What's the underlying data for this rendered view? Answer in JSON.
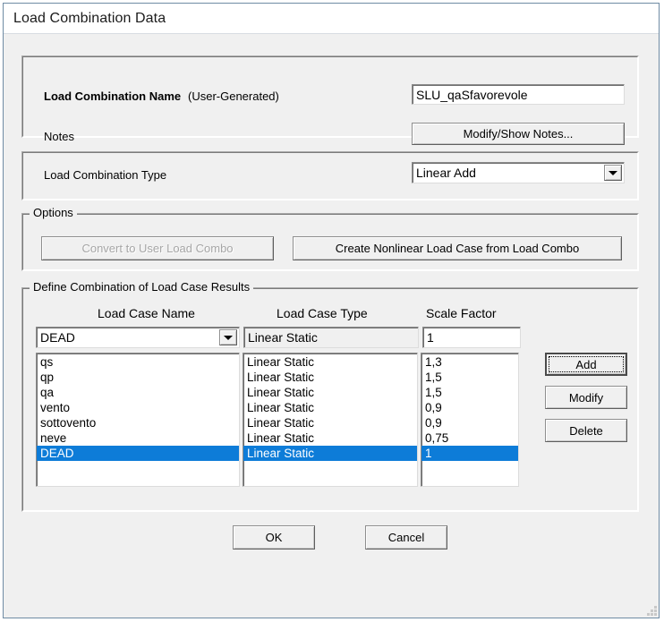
{
  "window": {
    "title": "Load Combination Data"
  },
  "name_panel": {
    "name_label_bold": "Load Combination Name",
    "name_label_suffix": "(User-Generated)",
    "name_value": "SLU_qaSfavorevole",
    "name_placeholder": "",
    "notes_label": "Notes",
    "notes_button": "Modify/Show Notes..."
  },
  "type_panel": {
    "type_label": "Load Combination Type",
    "type_value": "Linear Add",
    "type_options": [
      "Linear Add"
    ]
  },
  "options_group": {
    "title": "Options",
    "convert_button": "Convert to User Load Combo",
    "convert_button_enabled": false,
    "create_button": "Create Nonlinear Load Case from Load Combo"
  },
  "define_group": {
    "title": "Define Combination of Load Case Results",
    "headers": {
      "case_name": "Load Case Name",
      "case_type": "Load Case Type",
      "scale_factor": "Scale Factor"
    },
    "editor": {
      "case_name_value": "DEAD",
      "case_name_options": [
        "DEAD",
        "qs",
        "qp",
        "qa",
        "vento",
        "sottovento",
        "neve"
      ],
      "case_type_value": "Linear Static",
      "scale_factor_value": "1",
      "scale_factor_placeholder": ""
    },
    "rows": [
      {
        "name": "qs",
        "type": "Linear Static",
        "scale": "1,3",
        "selected": false
      },
      {
        "name": "qp",
        "type": "Linear Static",
        "scale": "1,5",
        "selected": false
      },
      {
        "name": "qa",
        "type": "Linear Static",
        "scale": "1,5",
        "selected": false
      },
      {
        "name": "vento",
        "type": "Linear Static",
        "scale": "0,9",
        "selected": false
      },
      {
        "name": "sottovento",
        "type": "Linear Static",
        "scale": "0,9",
        "selected": false
      },
      {
        "name": "neve",
        "type": "Linear Static",
        "scale": "0,75",
        "selected": false
      },
      {
        "name": "DEAD",
        "type": "Linear Static",
        "scale": "1",
        "selected": true
      }
    ],
    "side_buttons": {
      "add": "Add",
      "modify": "Modify",
      "delete": "Delete"
    }
  },
  "footer": {
    "ok": "OK",
    "cancel": "Cancel"
  },
  "colors": {
    "selection_blue": "#0d7cd8",
    "dialog_face": "#f0f0f0",
    "window_border": "#6f8ba4",
    "disabled_text": "#a6a6a6"
  }
}
